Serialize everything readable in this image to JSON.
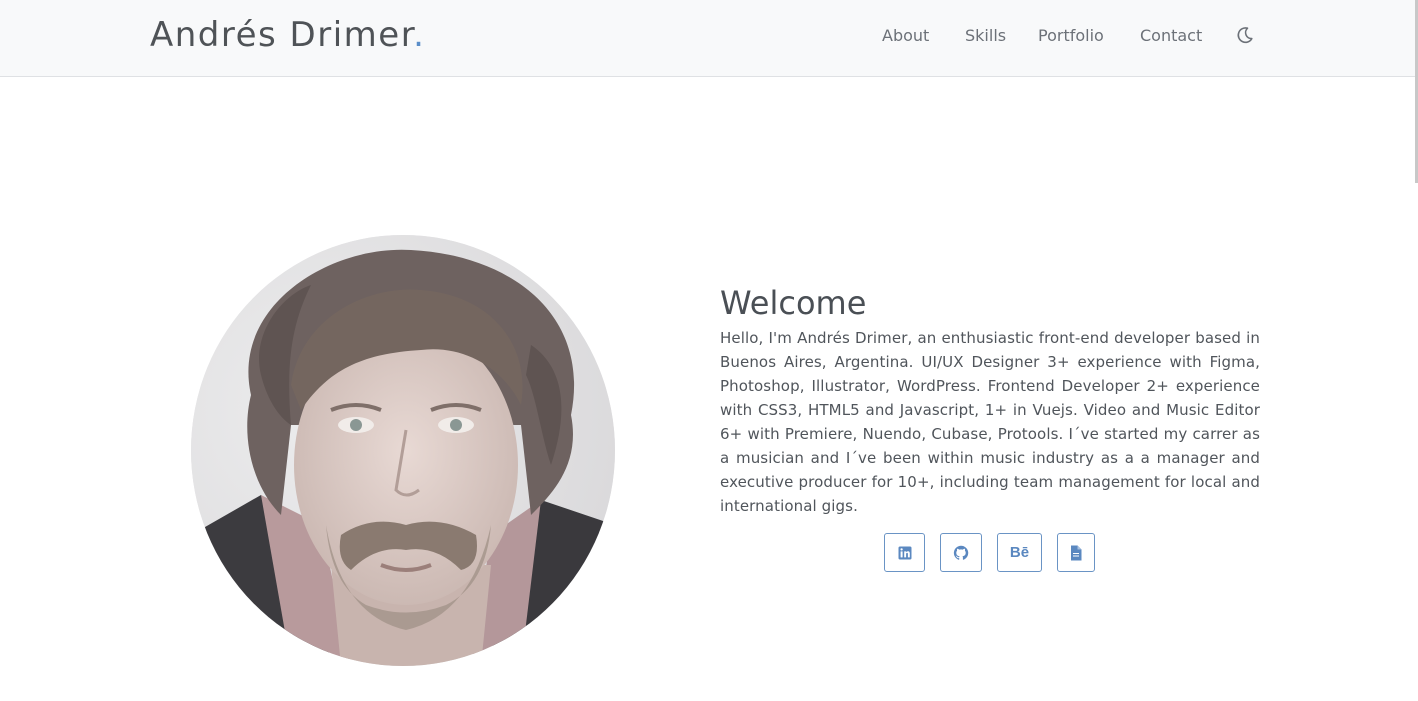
{
  "nav": {
    "brand": "Andrés Drimer",
    "brand_dot": ".",
    "links": [
      "About",
      "Skills",
      "Portfolio",
      "Contact"
    ],
    "theme_toggle_icon": "moon-icon"
  },
  "hero": {
    "title": "Welcome",
    "bio": "Hello, I'm Andrés Drimer, an enthusiastic front-end developer based in Buenos Aires, Argentina. UI/UX Designer 3+ experience with Figma, Photoshop, Illustrator, WordPress. Frontend Developer 2+ experience with CSS3, HTML5 and Javascript, 1+ in Vuejs. Video and Music Editor 6+ with Premiere, Nuendo, Cubase, Protools. I´ve started my carrer as a musician and I´ve been within music industry as a a manager and executive producer for 10+, including team management for local and international gigs.",
    "social": [
      {
        "icon": "linkedin-icon"
      },
      {
        "icon": "github-icon"
      },
      {
        "icon": "behance-icon",
        "text": "Bē"
      },
      {
        "icon": "document-icon"
      }
    ]
  },
  "colors": {
    "accent": "#5b8ec9",
    "navbar_bg": "#f8f9fa",
    "text": "#4a4f55"
  }
}
